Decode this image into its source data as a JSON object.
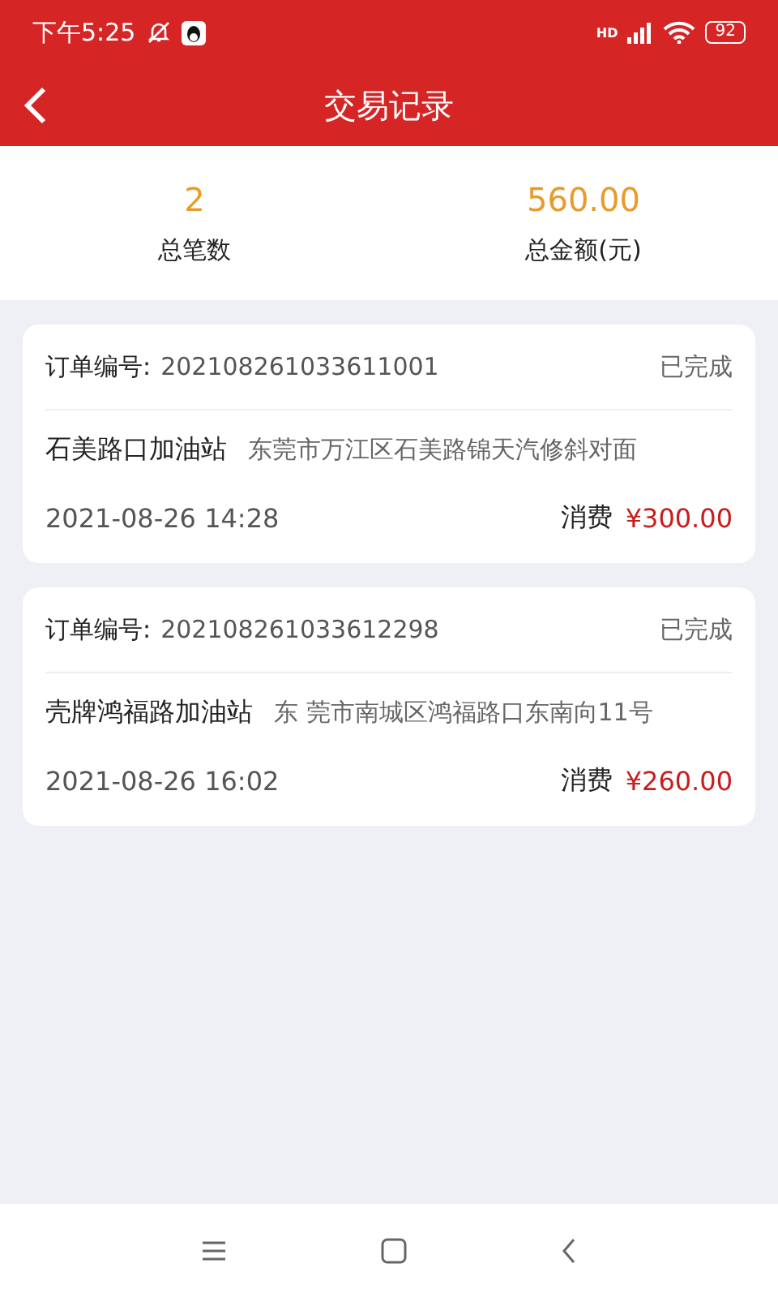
{
  "status_bar": {
    "time": "下午5:25",
    "network": "HD",
    "battery": "92"
  },
  "header": {
    "title": "交易记录"
  },
  "summary": [
    {
      "value": "2",
      "label": "总笔数"
    },
    {
      "value": "560.00",
      "label": "总金额(元)"
    }
  ],
  "orders": [
    {
      "order_label": "订单编号:",
      "order_no": "202108261033611001",
      "status": "已完成",
      "station": "石美路口加油站",
      "address": "东莞市万江区石美路锦天汽修斜对面",
      "time": "2021-08-26 14:28",
      "amount_label": "消费",
      "amount": "¥300.00"
    },
    {
      "order_label": "订单编号:",
      "order_no": "202108261033612298",
      "status": "已完成",
      "station": "壳牌鸿福路加油站",
      "address": "东 莞市南城区鸿福路口东南向11号",
      "time": "2021-08-26 16:02",
      "amount_label": "消费",
      "amount": "¥260.00"
    }
  ]
}
